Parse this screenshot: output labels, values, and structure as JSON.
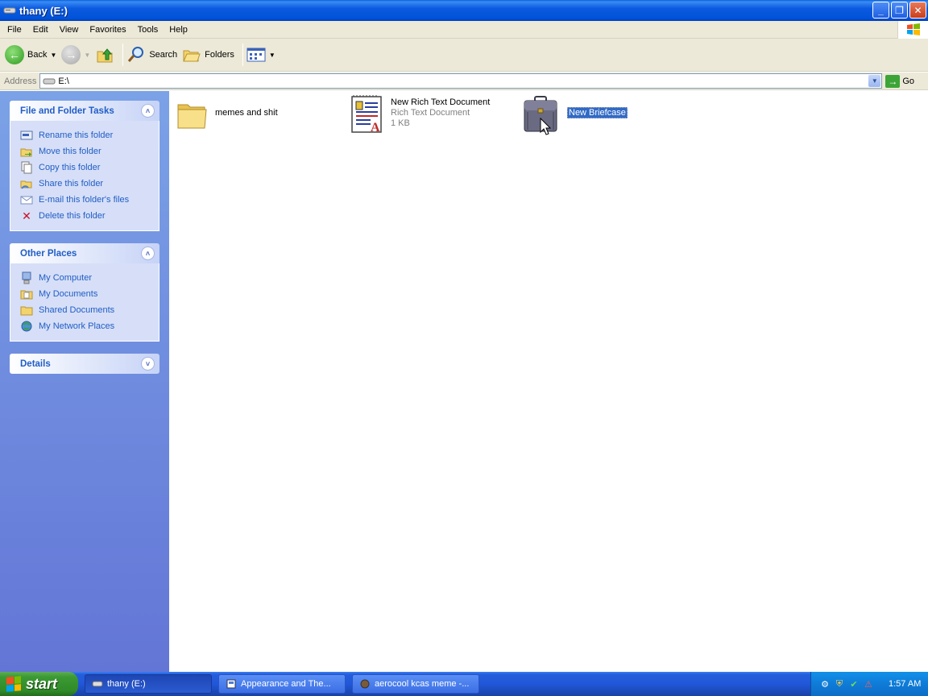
{
  "window": {
    "title": "thany (E:)",
    "buttons": {
      "minimize": "_",
      "restore": "❐",
      "close": "✕"
    }
  },
  "menu": [
    "File",
    "Edit",
    "View",
    "Favorites",
    "Tools",
    "Help"
  ],
  "toolbar": {
    "back_label": "Back",
    "search_label": "Search",
    "folders_label": "Folders"
  },
  "address": {
    "label": "Address",
    "value": "E:\\",
    "go_label": "Go"
  },
  "left_pane": {
    "file_tasks": {
      "title": "File and Folder Tasks",
      "items": [
        {
          "label": "Rename this folder",
          "icon": "rename-icon"
        },
        {
          "label": "Move this folder",
          "icon": "move-icon"
        },
        {
          "label": "Copy this folder",
          "icon": "copy-icon"
        },
        {
          "label": "Share this folder",
          "icon": "share-icon"
        },
        {
          "label": "E-mail this folder's files",
          "icon": "email-icon"
        },
        {
          "label": "Delete this folder",
          "icon": "delete-icon"
        }
      ]
    },
    "other_places": {
      "title": "Other Places",
      "items": [
        {
          "label": "My Computer",
          "icon": "my-computer-icon"
        },
        {
          "label": "My Documents",
          "icon": "my-documents-icon"
        },
        {
          "label": "Shared Documents",
          "icon": "shared-documents-icon"
        },
        {
          "label": "My Network Places",
          "icon": "network-icon"
        }
      ]
    },
    "details": {
      "title": "Details"
    }
  },
  "files": [
    {
      "name": "memes and shit",
      "type": "folder"
    },
    {
      "name": "New Rich Text Document",
      "subtype": "Rich Text Document",
      "size": "1 KB",
      "type": "rtf"
    },
    {
      "name": "New Briefcase",
      "type": "briefcase",
      "selected": true
    }
  ],
  "taskbar": {
    "start_label": "start",
    "tasks": [
      {
        "label": "thany (E:)",
        "active": true
      },
      {
        "label": "Appearance and The...",
        "active": false
      },
      {
        "label": "aerocool kcas meme -...",
        "active": false
      }
    ],
    "clock": "1:57 AM"
  }
}
